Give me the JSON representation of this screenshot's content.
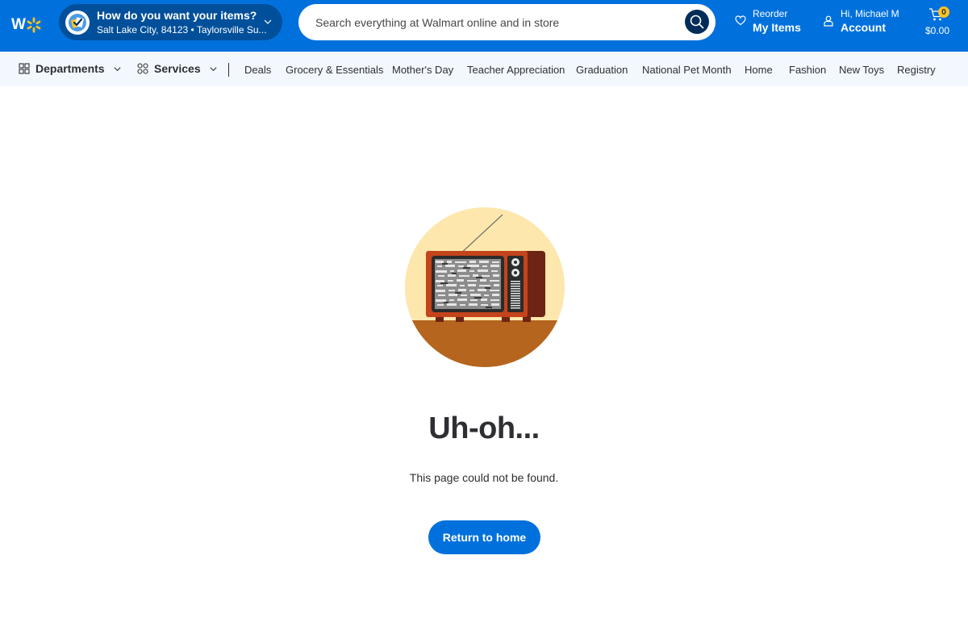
{
  "header": {
    "logo_alt": "Walmart",
    "logo_letter": "W",
    "fulfillment": {
      "title": "How do you want your items?",
      "location": "Salt Lake City, 84123 • Taylorsville Su..."
    },
    "search": {
      "placeholder": "Search everything at Walmart online and in store",
      "value": ""
    },
    "reorder": {
      "small": "Reorder",
      "big": "My Items"
    },
    "account": {
      "small": "Hi, Michael M",
      "big": "Account"
    },
    "cart": {
      "count": "0",
      "total": "$0.00"
    }
  },
  "nav": {
    "departments": "Departments",
    "services": "Services",
    "links": [
      "Deals",
      "Grocery & Essentials",
      "Mother's Day",
      "Teacher Appreciation",
      "Graduation",
      "National Pet Month",
      "Home",
      "Fashion",
      "New Toys",
      "Registry"
    ]
  },
  "main": {
    "title": "Uh-oh...",
    "message": "This page could not be found.",
    "button": "Return to home"
  },
  "colors": {
    "brand_blue": "#0071dc",
    "dark_blue": "#004f9a",
    "nav_bg": "#f2f8fd",
    "cart_badge": "#ffc220",
    "text": "#2e2f32"
  },
  "icons": {
    "logo": "walmart-spark-icon",
    "fulfillment": "delivery-check-icon",
    "search": "search-icon",
    "reorder": "heart-icon",
    "account": "user-icon",
    "cart": "cart-icon",
    "departments": "grid-icon",
    "services": "services-grid-icon",
    "chevron": "chevron-down-icon"
  }
}
